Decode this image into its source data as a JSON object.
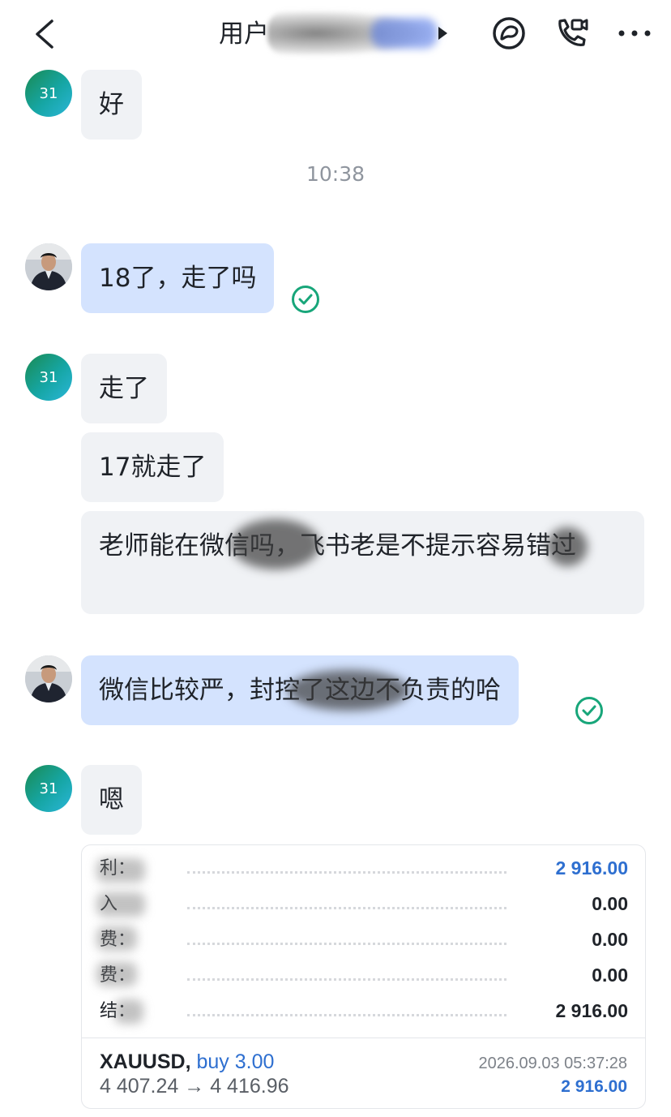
{
  "header": {
    "title": "用户",
    "back_icon": "chevron-left-icon",
    "icons": [
      "search-chat-icon",
      "video-call-icon",
      "more-icon"
    ]
  },
  "avatars": {
    "group_label": "31"
  },
  "messages": [
    {
      "sender": "group",
      "text": "好"
    },
    {
      "sender": "self",
      "text": "18了，走了吗",
      "read": true
    },
    {
      "sender": "group",
      "text": "走了"
    },
    {
      "sender": "group",
      "text": "17就走了"
    },
    {
      "sender": "group",
      "text": "老师能在微信吗，飞书老是不提示容易错过"
    },
    {
      "sender": "self",
      "text": "微信比较严，封控了这边不负责的哈",
      "read": true
    },
    {
      "sender": "group",
      "text": "嗯"
    }
  ],
  "timestamp": "10:38",
  "trade_card": {
    "rows": [
      {
        "label": "利：",
        "value": "2 916.00",
        "highlight": true
      },
      {
        "label": "入",
        "value": "0.00",
        "highlight": false
      },
      {
        "label": "费：",
        "value": "0.00",
        "highlight": false
      },
      {
        "label": "费：",
        "value": "0.00",
        "highlight": false
      },
      {
        "label": "结：",
        "value": "2 916.00",
        "highlight": false
      }
    ],
    "symbol": "XAUUSD,",
    "direction": "buy 3.00",
    "prices": "4 407.24 → 4 416.96",
    "datetime": "2026.09.03 05:37:28",
    "profit": "2 916.00",
    "accent_color": "#2e6fd0"
  },
  "colors": {
    "bubble_in": "#f0f2f5",
    "bubble_out": "#d4e3fe",
    "check": "#18a67a"
  }
}
